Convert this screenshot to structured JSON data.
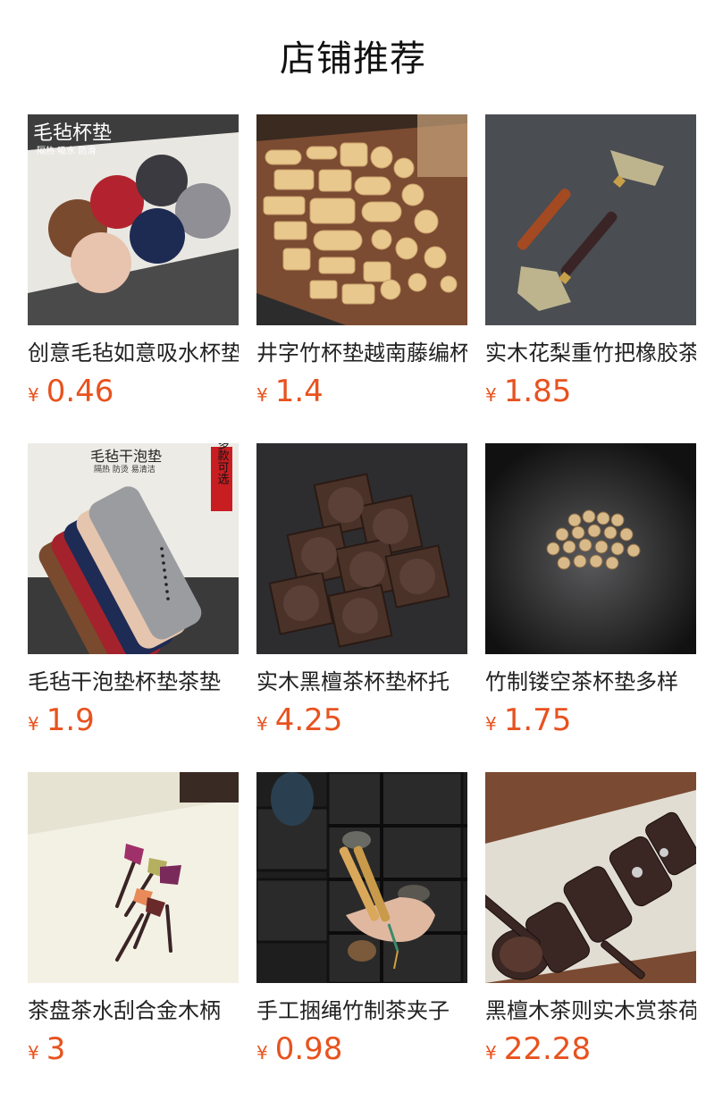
{
  "page_title": "店铺推荐",
  "currency_symbol": "¥",
  "accent_color": "#e8521e",
  "products": [
    {
      "name": "创意毛毡如意吸水杯垫",
      "price": "0.46",
      "image_text": "毛毡杯垫",
      "image_subtext": "隔热 吸水 防滑"
    },
    {
      "name": "井字竹杯垫越南藤编杯垫",
      "price": "1.4"
    },
    {
      "name": "实木花梨重竹把橡胶茶刮",
      "price": "1.85"
    },
    {
      "name": "毛毡干泡垫杯垫茶垫",
      "price": "1.9",
      "image_text": "毛毡干泡垫",
      "image_subtext": "隔热 防烫 易清洁",
      "image_badge": "多款可选"
    },
    {
      "name": "实木黑檀茶杯垫杯托",
      "price": "4.25"
    },
    {
      "name": "竹制镂空茶杯垫多样",
      "price": "1.75"
    },
    {
      "name": "茶盘茶水刮合金木柄",
      "price": "3"
    },
    {
      "name": "手工捆绳竹制茶夹子",
      "price": "0.98"
    },
    {
      "name": "黑檀木茶则实木赏茶荷",
      "price": "22.28"
    }
  ]
}
